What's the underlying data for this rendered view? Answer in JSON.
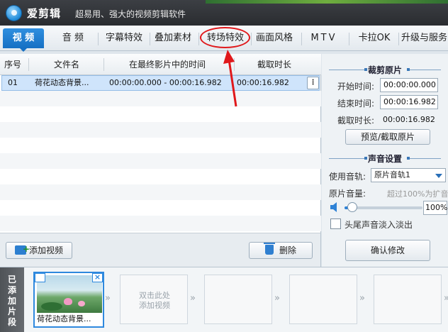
{
  "app": {
    "name": "爱剪辑",
    "slogan": "超易用、强大的视频剪辑软件"
  },
  "tabs": [
    {
      "label": "视 频",
      "active": true
    },
    {
      "label": "音 频"
    },
    {
      "label": "字幕特效"
    },
    {
      "label": "叠加素材"
    },
    {
      "label": "转场特效",
      "highlighted": true
    },
    {
      "label": "画面风格"
    },
    {
      "label": "MTV"
    },
    {
      "label": "卡拉OK"
    },
    {
      "label": "升级与服务"
    }
  ],
  "table": {
    "headers": [
      "序号",
      "文件名",
      "在最终影片中的时间",
      "截取时长"
    ],
    "rows": [
      {
        "index": "01",
        "filename": "荷花动态背景...",
        "time_range": "00:00:00.000 - 00:00:16.982",
        "duration": "00:00:16.982"
      }
    ]
  },
  "actions": {
    "add_video": "添加视频",
    "delete": "删除"
  },
  "crop": {
    "title": "裁剪原片",
    "start_label": "开始时间:",
    "start_value": "00:00:00.000",
    "end_label": "结束时间:",
    "end_value": "00:00:16.982",
    "duration_label": "截取时长:",
    "duration_value": "00:00:16.982",
    "preview_button": "预览/截取原片"
  },
  "audio": {
    "title": "声音设置",
    "track_label": "使用音轨:",
    "track_value": "原片音轨1",
    "volume_label": "原片音量:",
    "volume_hint": "超过100%为扩音",
    "volume_value": "100%",
    "volume_level": 0.1,
    "fade_label": "头尾声音淡入淡出",
    "confirm_button": "确认修改"
  },
  "strip": {
    "side_label": "已添加片段",
    "clip_name": "荷花动态背景...",
    "add_hint_line1": "双击此处",
    "add_hint_line2": "添加视频"
  },
  "colors": {
    "accent": "#1670c4",
    "highlight": "#e0181b"
  }
}
